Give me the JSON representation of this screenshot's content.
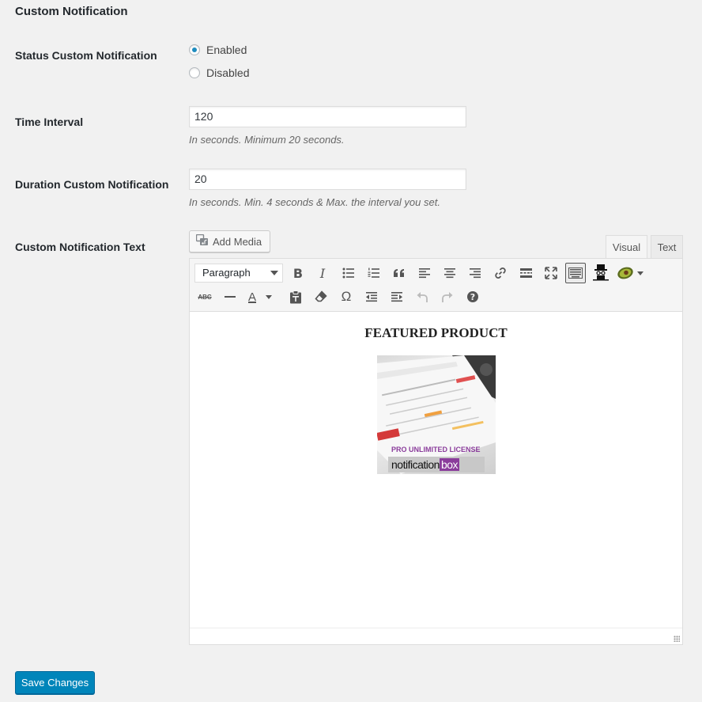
{
  "section": {
    "title": "Custom Notification"
  },
  "status": {
    "label": "Status Custom Notification",
    "options": [
      {
        "label": "Enabled",
        "checked": true
      },
      {
        "label": "Disabled",
        "checked": false
      }
    ]
  },
  "interval": {
    "label": "Time Interval",
    "value": "120",
    "description": "In seconds. Minimum 20 seconds."
  },
  "duration": {
    "label": "Duration Custom Notification",
    "value": "20",
    "description": "In seconds. Min. 4 seconds & Max. the interval you set."
  },
  "text": {
    "label": "Custom Notification Text",
    "add_media": "Add Media",
    "tabs": {
      "visual": "Visual",
      "text": "Text"
    },
    "format_select": "Paragraph",
    "content": {
      "heading": "FEATURED PRODUCT",
      "image_caption": "PRO UNLIMITED LICENSE",
      "image_logo_left": "notification",
      "image_logo_right": "box"
    }
  },
  "footer": {
    "save_label": "Save Changes"
  },
  "colors": {
    "primary": "#0085ba",
    "radio_checked": "#1e8cbe",
    "logo_purple": "#8a3c9b"
  }
}
